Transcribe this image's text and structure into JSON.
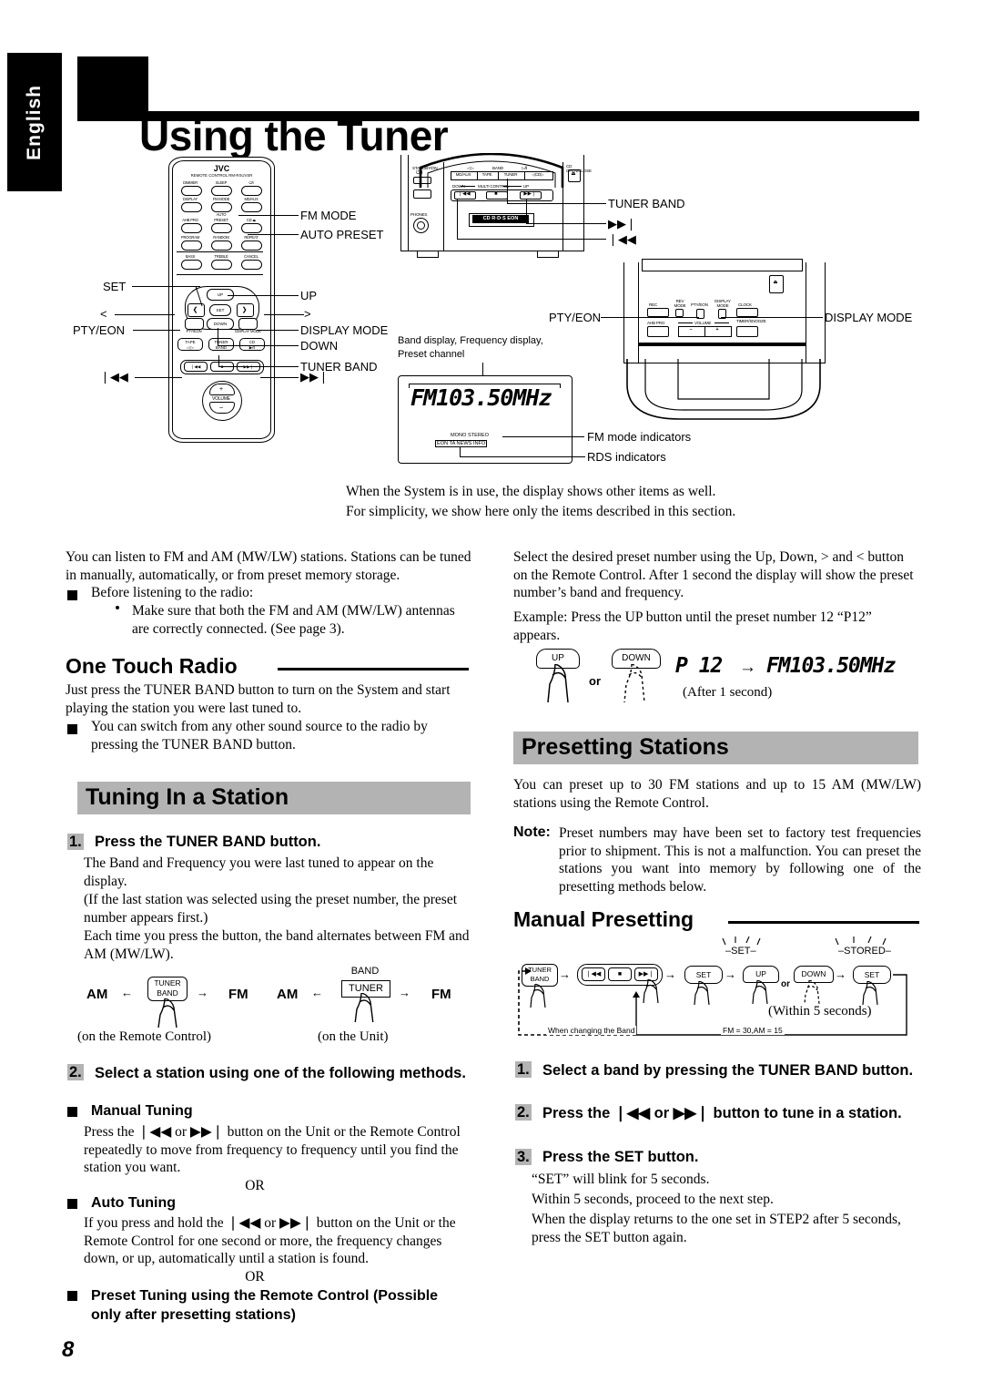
{
  "page": {
    "title": "Using the Tuner",
    "language_tab": "English",
    "page_number": "8"
  },
  "remote": {
    "brand": "JVC",
    "model_line": "REMOTE CONTROL RM-RXUVSR",
    "buttons_row1": [
      "DIMMER",
      "SLEEP",
      "⏻/I"
    ],
    "buttons_row2": [
      "DISPLAY",
      "FM MODE",
      "MD/AUX"
    ],
    "auto_label": "AUTO",
    "buttons_row3": [
      "AHB PRO",
      "PRESET",
      "CD ⏏"
    ],
    "buttons_row4": [
      "PROGRAM",
      "RANDOM",
      "REPEAT"
    ],
    "buttons_row5": [
      "BASS",
      "TREBLE",
      "CANCEL"
    ],
    "up": "UP",
    "down": "DOWN",
    "set": "SET",
    "left_chevron": "❮",
    "right_chevron": "❯",
    "pty_eon": "PTY/EON",
    "display_mode": "DISPLAY MODE",
    "source_tape": "TAPE",
    "source_tape_sub": "◁ ▷",
    "source_tuner": "TUNER",
    "source_tuner_sub": "BAND",
    "source_cd": "CD",
    "source_cd_sub": "▶/‖",
    "trans_prev": "❘◀◀",
    "trans_stop": "■",
    "trans_next": "▶▶❘",
    "volume": "VOLUME",
    "vol_plus": "+",
    "vol_minus": "–"
  },
  "callouts": {
    "fm_mode": "FM MODE",
    "auto_preset": "AUTO PRESET",
    "set": "SET",
    "up": "UP",
    "left_angle": "<",
    "right_angle": ">",
    "pty_eon": "PTY/EON",
    "display_mode": "DISPLAY MODE",
    "down": "DOWN",
    "tuner_band": "TUNER BAND",
    "prev": "❘◀◀",
    "next": "▶▶❘",
    "unit_tuner_band": "TUNER BAND",
    "unit_next": "▶▶❘",
    "unit_prev": "❘◀◀",
    "unit_pty_eon": "PTY/EON",
    "unit_display_mode": "DISPLAY MODE",
    "display_caption_line1": "Band display, Frequency display,",
    "display_caption_line2": "Preset channel",
    "fm_mode_indicators": "FM mode indicators",
    "rds_indicators": "RDS indicators"
  },
  "unit_top": {
    "standby_label": "STANDBY/ON",
    "standby_icon": "⏻/I",
    "phones": "PHONES",
    "source_md_aux": "MD/AUX",
    "source_tape": "TAPE",
    "source_tuner": "TUNER",
    "source_cd": "◁CD▷",
    "band_label": "BAND",
    "left_marks": "◁ ▷",
    "right_marks": "▷/‖",
    "multi_control": "MULTI CONTROL",
    "down_label": "DOWN",
    "up_label": "UP",
    "prev": "❘◀◀",
    "stop": "■",
    "next": "▶▶❘",
    "cd_open_close": "CD OPEN/CLOSE",
    "eject": "⏏",
    "badge": "CD R·D·S EON"
  },
  "unit_right": {
    "rec": "REC",
    "rev_mode": "REV MODE",
    "pty_eon": "PTY/EON",
    "display_mode": "DISPLAY MODE",
    "clock": "CLOCK",
    "ahb_pro": "AHB PRO",
    "volume": "VOLUME",
    "vol_minus": "–",
    "vol_plus": "+",
    "timer_snooze": "TIMER/SNOOZE",
    "eject": "⏏"
  },
  "lcd": {
    "main_text": "FM103.50MHz",
    "fm_mode_indicators": "MONO STEREO",
    "rds_indicators": "EON TA NEWS INFO"
  },
  "intro_notes": [
    "When the System is in use, the display shows other items as well.",
    "For simplicity, we show here only the items described in this section."
  ],
  "left_column": {
    "intro_p1": "You can listen to FM and AM (MW/LW) stations. Stations can be tuned in manually, automatically, or from preset memory storage.",
    "bullet1": "Before listening to the radio:",
    "subbullet1": "Make sure that both the FM and AM (MW/LW) antennas are correctly connected. (See page 3).",
    "one_touch_heading": "One Touch Radio",
    "one_touch_p1": "Just press the TUNER BAND button to turn on the System and start playing the station you were last tuned to.",
    "one_touch_bullet": "You can switch from any other sound source to the radio by pressing the TUNER BAND button.",
    "tuning_heading": "Tuning In a Station",
    "step1_num": "1.",
    "step1_head": "Press the TUNER BAND button.",
    "step1_p1": "The Band and Frequency you were last tuned to appear on the display.",
    "step1_p2": "(If the last station was selected using the preset number, the preset number appears first.)",
    "step1_p3": "Each time you press the button, the band alternates between FM and AM (MW/LW).",
    "band_diagram": {
      "am": "AM",
      "fm": "FM",
      "arrow_left": "←",
      "arrow_right": "→",
      "remote_button_line1": "TUNER",
      "remote_button_line2": "BAND",
      "unit_button": "TUNER",
      "unit_button_top": "BAND",
      "caption_remote": "(on the Remote Control)",
      "caption_unit": "(on the Unit)"
    },
    "step2_num": "2.",
    "step2_head": "Select a station using one of the following methods.",
    "manual_tuning_head": "Manual Tuning",
    "manual_tuning_p": "Press the ❘◀◀ or ▶▶❘ button on the Unit or the Remote Control repeatedly to move from frequency to frequency until you find the station you want.",
    "or1": "OR",
    "auto_tuning_head": "Auto Tuning",
    "auto_tuning_p": "If you press and hold the ❘◀◀ or ▶▶❘ button on the Unit or the Remote Control for one second or more, the frequency changes down, or up, automatically until a station is found.",
    "or2": "OR",
    "preset_tuning_head": "Preset Tuning using the Remote Control (Possible only after presetting stations)"
  },
  "right_column": {
    "preset_p1": "Select the desired preset number using the Up, Down, > and < button on the Remote Control. After 1 second the display will show the preset number’s band and frequency.",
    "preset_p2": "Example: Press the UP button until the preset number 12 “P12” appears.",
    "updown_diagram": {
      "up": "UP",
      "down": "DOWN",
      "or": "or",
      "lcd_preset": "P 12",
      "arrow": "→",
      "lcd_freq": "FM103.50MHz",
      "after_caption": "(After 1 second)"
    },
    "presetting_heading": "Presetting Stations",
    "presetting_p1": "You can preset up to 30 FM stations and up to 15 AM (MW/LW) stations using the Remote Control.",
    "note_label": "Note:",
    "note_body": "Preset numbers may have been set to factory test frequencies prior to shipment. This is not a malfunction. You can preset the stations you want into memory by following one of the presetting methods below.",
    "manual_presetting_heading": "Manual Presetting",
    "flow": {
      "tuner_band_line1": "TUNER",
      "tuner_band_line2": "BAND",
      "prev": "❘◀◀",
      "stop": "■",
      "next": "▶▶❘",
      "set": "SET",
      "up": "UP",
      "down": "DOWN",
      "or": "or",
      "set2": "SET",
      "blink_set": "SET",
      "blink_stored": "STORED",
      "caption_band": "When changing the Band",
      "caption_counts": "FM = 30,AM = 15",
      "caption_within": "(Within 5 seconds)",
      "arrow": "→"
    },
    "step1_num": "1.",
    "step1_head": "Select a band by pressing the TUNER BAND button.",
    "step2_num": "2.",
    "step2_head": "Press the ❘◀◀ or ▶▶❘ button to tune in a station.",
    "step3_num": "3.",
    "step3_head": "Press the SET button.",
    "step3_p1": "“SET” will blink for 5 seconds.",
    "step3_p2": "Within 5 seconds, proceed to the next step.",
    "step3_p3": "When the display returns to the one set in STEP2 after 5 seconds, press the SET button again."
  }
}
